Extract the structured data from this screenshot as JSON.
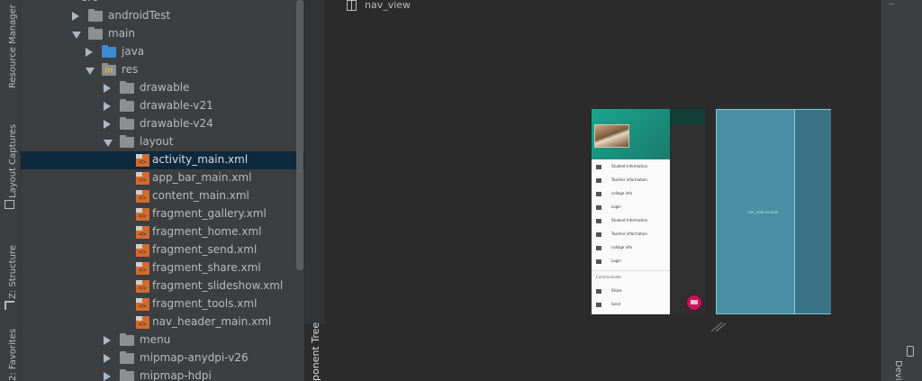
{
  "tool_windows": {
    "left": [
      "Resource Manager",
      "Layout Captures",
      "Z: Structure",
      "2: Favorites"
    ],
    "component_tree": "ponent Tree",
    "right": "Devi"
  },
  "project_tree": {
    "top_partial": "src",
    "items": [
      {
        "label": "androidTest",
        "type": "folder",
        "expanded": false
      },
      {
        "label": "main",
        "type": "folder",
        "expanded": true
      },
      {
        "label": "java",
        "type": "folder-blue",
        "expanded": false
      },
      {
        "label": "res",
        "type": "folder-res",
        "expanded": true
      },
      {
        "label": "drawable",
        "type": "folder",
        "expanded": false
      },
      {
        "label": "drawable-v21",
        "type": "folder",
        "expanded": false
      },
      {
        "label": "drawable-v24",
        "type": "folder",
        "expanded": false
      },
      {
        "label": "layout",
        "type": "folder",
        "expanded": true
      },
      {
        "label": "activity_main.xml",
        "type": "xml",
        "selected": true
      },
      {
        "label": "app_bar_main.xml",
        "type": "xml"
      },
      {
        "label": "content_main.xml",
        "type": "xml"
      },
      {
        "label": "fragment_gallery.xml",
        "type": "xml"
      },
      {
        "label": "fragment_home.xml",
        "type": "xml"
      },
      {
        "label": "fragment_send.xml",
        "type": "xml"
      },
      {
        "label": "fragment_share.xml",
        "type": "xml"
      },
      {
        "label": "fragment_slideshow.xml",
        "type": "xml"
      },
      {
        "label": "fragment_tools.xml",
        "type": "xml"
      },
      {
        "label": "nav_header_main.xml",
        "type": "xml"
      },
      {
        "label": "menu",
        "type": "folder",
        "expanded": false
      },
      {
        "label": "mipmap-anydpi-v26",
        "type": "folder",
        "expanded": false
      },
      {
        "label": "mipmap-hdpi",
        "type": "folder",
        "expanded": false
      }
    ]
  },
  "editor": {
    "selected_component": "nav_view"
  },
  "preview": {
    "menu_items": [
      {
        "label": "Student Information",
        "icon": "camera-icon"
      },
      {
        "label": "Teacher information",
        "icon": "gallery-icon"
      },
      {
        "label": "collage info",
        "icon": "slideshow-icon"
      },
      {
        "label": "Login",
        "icon": "wrench-icon"
      },
      {
        "label": "Student Information",
        "icon": "camera-icon"
      },
      {
        "label": "Teacher information",
        "icon": "gallery-icon"
      },
      {
        "label": "collage info",
        "icon": "slideshow-icon"
      },
      {
        "label": "Login",
        "icon": "wrench-icon"
      }
    ],
    "section_title": "Communicate",
    "section_items": [
      {
        "label": "Share",
        "icon": "share-icon"
      },
      {
        "label": "Send",
        "icon": "send-icon"
      }
    ],
    "blueprint_label": "nav_view    include",
    "colors": {
      "header": "#1aa48f",
      "fab": "#c2185b",
      "blueprint": "#4a8ea3"
    }
  }
}
